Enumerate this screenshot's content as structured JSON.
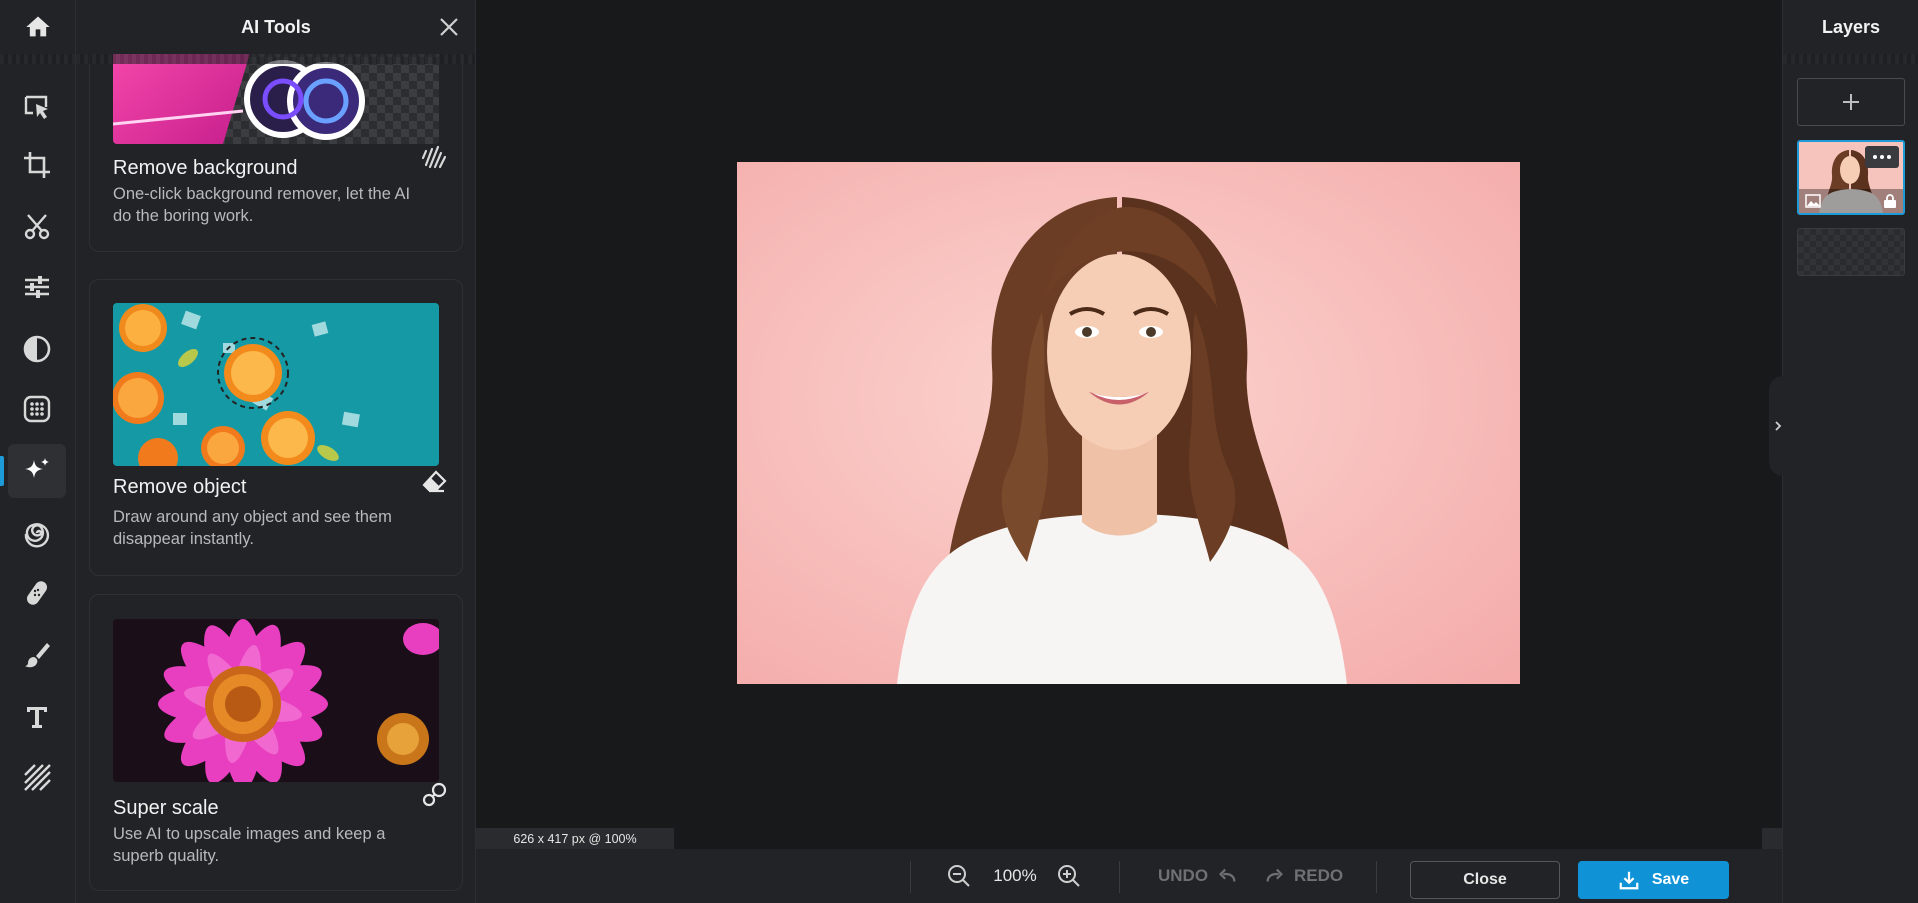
{
  "panel": {
    "title": "AI Tools",
    "cards": [
      {
        "title": "Remove background",
        "description": "One-click background remover, let the AI do the boring work."
      },
      {
        "title": "Remove object",
        "description": "Draw around any object and see them disappear instantly."
      },
      {
        "title": "Super scale",
        "description": "Use AI to upscale images and keep a superb quality."
      }
    ]
  },
  "rail": {
    "items": [
      "home-icon",
      "select-icon",
      "crop-icon",
      "cut-icon",
      "adjust-icon",
      "contrast-icon",
      "filters-icon",
      "ai-tools-icon",
      "spiral-effects-icon",
      "retouch-bandage-icon",
      "brush-icon",
      "text-icon",
      "textures-icon"
    ],
    "active": "ai-tools-icon"
  },
  "canvas": {
    "size_info": "626 x 417 px @ 100%"
  },
  "bottombar": {
    "zoom": "100%",
    "undo": "UNDO",
    "redo": "REDO",
    "close": "Close",
    "save": "Save"
  },
  "layers": {
    "title": "Layers"
  },
  "colors": {
    "accent": "#0f93d6",
    "background": "#18191b",
    "panel": "#222326"
  }
}
